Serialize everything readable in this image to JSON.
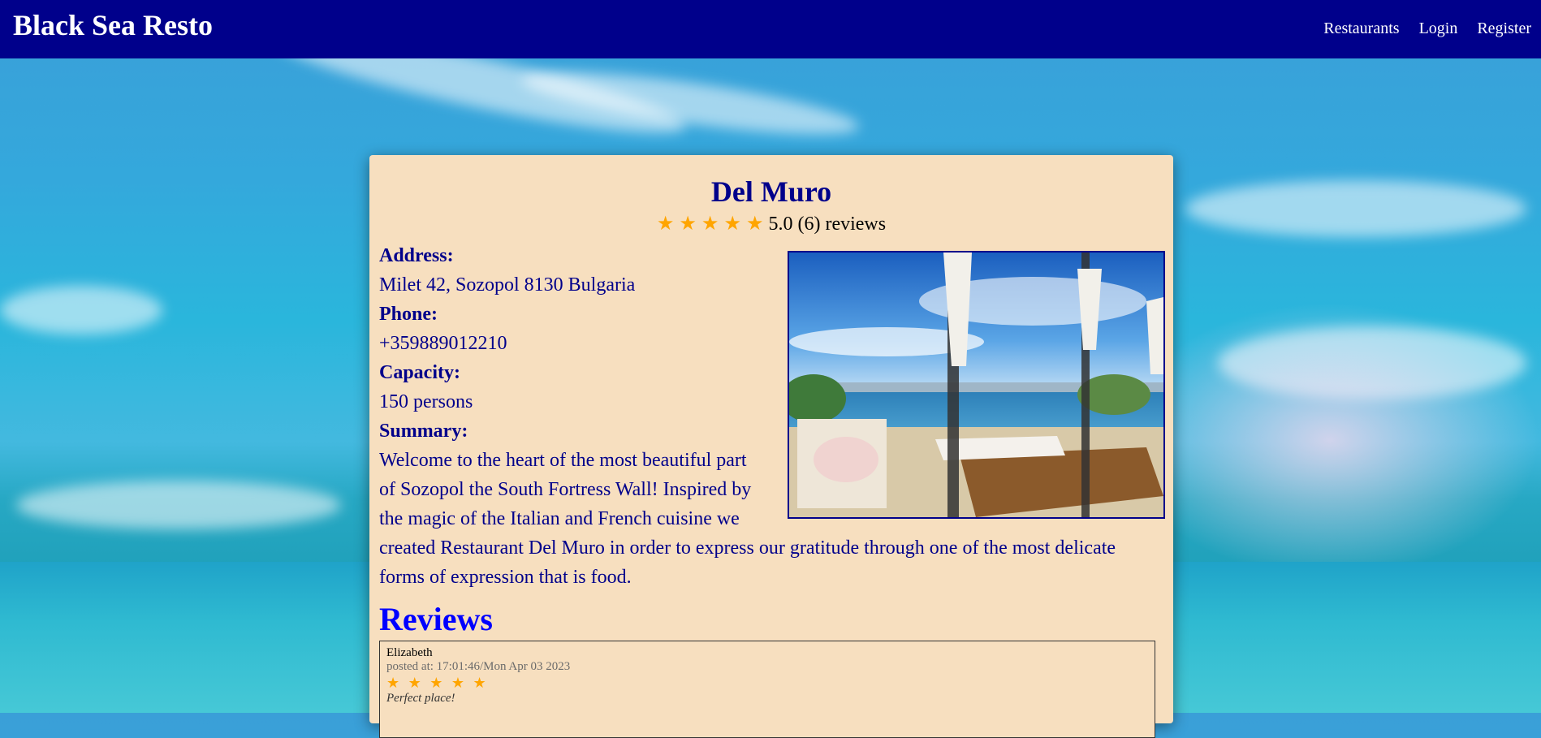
{
  "app": {
    "brand": "Black Sea Resto",
    "nav": [
      {
        "label": "Restaurants"
      },
      {
        "label": "Login"
      },
      {
        "label": "Register"
      }
    ]
  },
  "restaurant": {
    "name": "Del Muro",
    "stars_count": 5,
    "rating_value": "5.0",
    "reviews_count": "(6)",
    "reviews_word": "reviews",
    "address_label": "Address:",
    "address": "Milet 42, Sozopol 8130 Bulgaria",
    "phone_label": "Phone:",
    "phone": "+359889012210",
    "capacity_label": "Capacity:",
    "capacity": "150 persons",
    "summary_label": "Summary:",
    "summary": "Welcome to the heart of the most beautiful part of Sozopol the South Fortress Wall! Inspired by the magic of the Italian and French cuisine we created Restaurant Del Muro in order to express our gratitude through one of the most delicate forms of expression that is food."
  },
  "reviews_section": {
    "title": "Reviews",
    "items": [
      {
        "author": "Elizabeth",
        "posted": "posted at: 17:01:46/Mon Apr 03 2023",
        "stars": "★ ★ ★ ★ ★",
        "comment": "Perfect place!"
      }
    ]
  },
  "icons": {
    "star": "star-icon",
    "restaurant_photo": "terrace-photo"
  },
  "colors": {
    "navbar": "#00008b",
    "card": "#f7dfbf",
    "star": "#ffa500",
    "reviews_title": "#0000ff"
  }
}
